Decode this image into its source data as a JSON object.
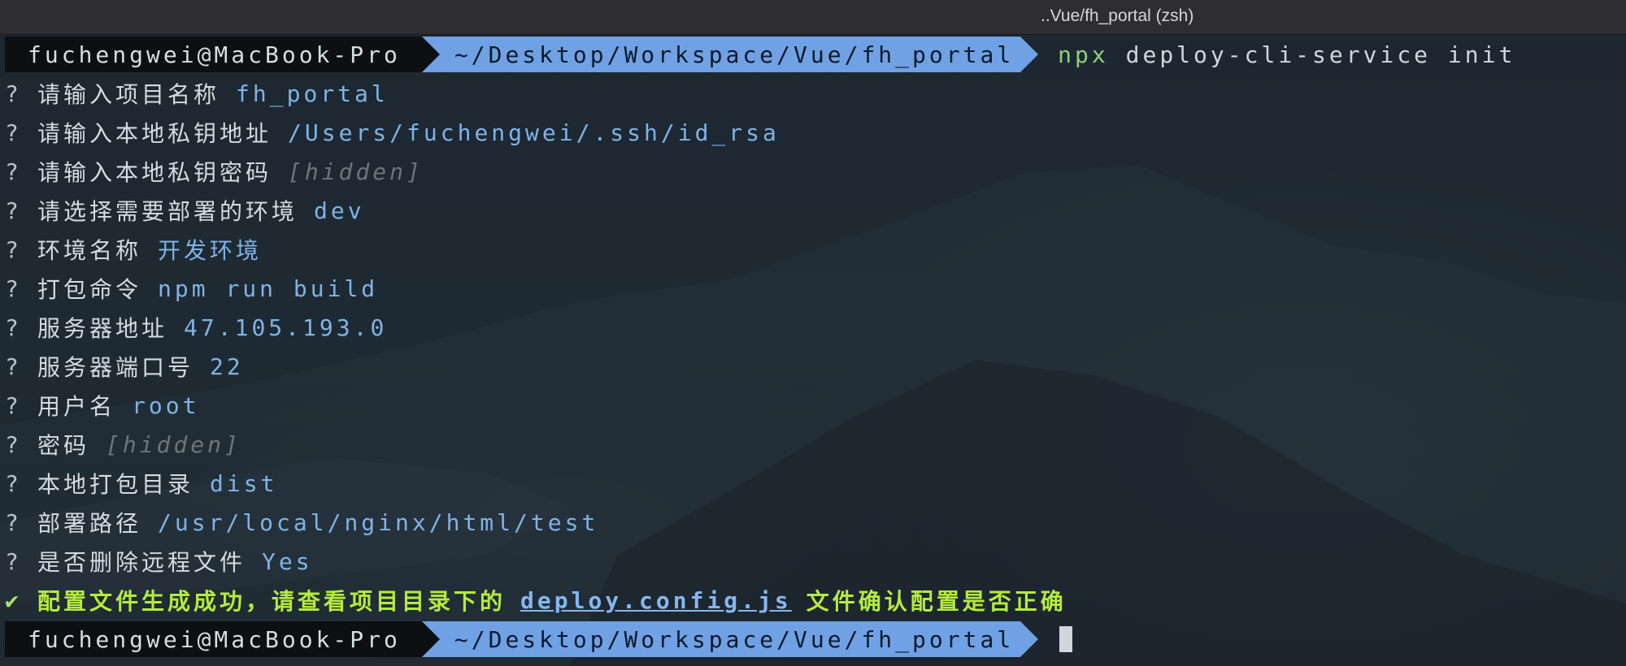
{
  "window": {
    "title": "..Vue/fh_portal (zsh)"
  },
  "prompt": {
    "user": "fuchengwei@MacBook-Pro",
    "path": "~/Desktop/Workspace/Vue/fh_portal",
    "command_npx": "npx",
    "command_rest": "deploy-cli-service init"
  },
  "questions": [
    {
      "marker": "?",
      "label": "请输入项目名称",
      "value": "fh_portal",
      "masked": false
    },
    {
      "marker": "?",
      "label": "请输入本地私钥地址",
      "value": "/Users/fuchengwei/.ssh/id_rsa",
      "masked": false
    },
    {
      "marker": "?",
      "label": "请输入本地私钥密码",
      "value": "[hidden]",
      "masked": true
    },
    {
      "marker": "?",
      "label": "请选择需要部署的环境",
      "value": "dev",
      "masked": false
    },
    {
      "marker": "?",
      "label": "环境名称",
      "value": "开发环境",
      "masked": false
    },
    {
      "marker": "?",
      "label": "打包命令",
      "value": "npm run build",
      "masked": false
    },
    {
      "marker": "?",
      "label": "服务器地址",
      "value": "47.105.193.0",
      "masked": false
    },
    {
      "marker": "?",
      "label": "服务器端口号",
      "value": "22",
      "masked": false
    },
    {
      "marker": "?",
      "label": "用户名",
      "value": "root",
      "masked": false
    },
    {
      "marker": "?",
      "label": "密码",
      "value": "[hidden]",
      "masked": true
    },
    {
      "marker": "?",
      "label": "本地打包目录",
      "value": "dist",
      "masked": false
    },
    {
      "marker": "?",
      "label": "部署路径",
      "value": "/usr/local/nginx/html/test",
      "masked": false
    },
    {
      "marker": "?",
      "label": "是否删除远程文件",
      "value": "Yes",
      "masked": false
    }
  ],
  "result": {
    "marker": "✔",
    "prefix": "配置文件生成成功，请查看项目目录下的",
    "file": "deploy.config.js",
    "suffix": "文件确认配置是否正确"
  },
  "prompt2": {
    "user": "fuchengwei@MacBook-Pro",
    "path": "~/Desktop/Workspace/Vue/fh_portal"
  },
  "colors": {
    "prompt_path_bg": "#6fa1e4",
    "answer": "#7fb3e6",
    "success": "#b4ec3c",
    "command": "#8fd07a"
  }
}
